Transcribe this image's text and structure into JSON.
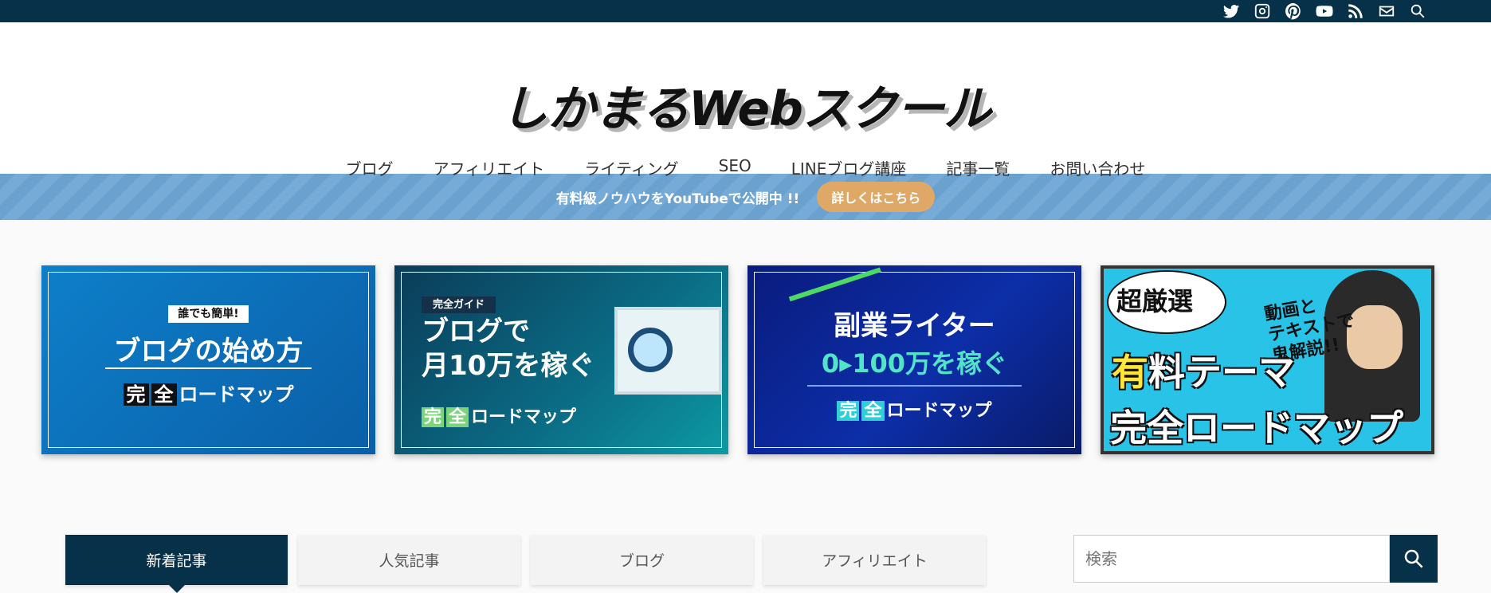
{
  "topbar": {
    "icons": [
      "twitter-icon",
      "instagram-icon",
      "pinterest-icon",
      "youtube-icon",
      "rss-icon",
      "mail-icon",
      "search-icon"
    ]
  },
  "header": {
    "logo_text": "しかまるWebスクール"
  },
  "nav": {
    "items": [
      "ブログ",
      "アフィリエイト",
      "ライティング",
      "SEO",
      "LINEブログ講座",
      "記事一覧",
      "お問い合わせ"
    ]
  },
  "notice": {
    "message": "有料級ノウハウをYouTubeで公開中 !!",
    "button": "詳しくはこちら"
  },
  "cards": {
    "c1": {
      "badge": "誰でも簡単!",
      "title": "ブログの始め方",
      "kan": "完",
      "zen": "全",
      "road": "ロードマップ"
    },
    "c2": {
      "badge": "完全ガイド",
      "title1": "ブログで",
      "title2": "月10万を稼ぐ",
      "kan": "完",
      "zen": "全",
      "road": "ロードマップ"
    },
    "c3": {
      "title1": "副業ライター",
      "title2": "0▸100万を稼ぐ",
      "kan": "完",
      "zen": "全",
      "road": "ロードマップ"
    },
    "c4": {
      "t1": "超厳選",
      "t2a": "有",
      "t2b": "料テーマ",
      "t3": "完全ロードマップ",
      "t4": "動画と\nテキストで\n鬼解説!!"
    }
  },
  "tabs": [
    "新着記事",
    "人気記事",
    "ブログ",
    "アフィリエイト"
  ],
  "search": {
    "placeholder": "検索"
  },
  "colors": {
    "navy": "#063149",
    "notice_button": "#e0a866",
    "notice_stripe": "#6aa1cf"
  }
}
